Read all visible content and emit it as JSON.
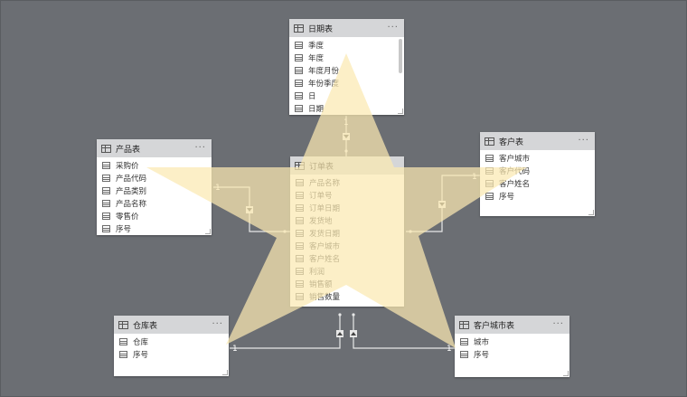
{
  "tables": {
    "date": {
      "title": "日期表",
      "fields": [
        "季度",
        "年度",
        "年度月份",
        "年份季度",
        "日",
        "日期"
      ]
    },
    "product": {
      "title": "产品表",
      "fields": [
        "采购价",
        "产品代码",
        "产品类别",
        "产品名称",
        "零售价",
        "序号"
      ]
    },
    "customer": {
      "title": "客户表",
      "fields": [
        "客户城市",
        "客户代码",
        "客户姓名",
        "序号"
      ]
    },
    "order": {
      "title": "订单表",
      "fields": [
        "产品名称",
        "订单号",
        "订单日期",
        "发货地",
        "发货日期",
        "客户城市",
        "客户姓名",
        "利润",
        "销售额",
        "销售数量"
      ]
    },
    "warehouse": {
      "title": "仓库表",
      "fields": [
        "仓库",
        "序号"
      ]
    },
    "customer_city": {
      "title": "客户城市表",
      "fields": [
        "城市",
        "序号"
      ]
    }
  },
  "relationships": {
    "one_label": "1",
    "many_label": "*",
    "date_one": "1",
    "product_one": "1",
    "customer_one": "1",
    "warehouse_one": "1",
    "city_one": "1"
  },
  "more_icon_glyph": "···",
  "colors": {
    "canvas": "#6b6e73",
    "card_header": "#d5d6d8",
    "line": "#e8e8e8",
    "star_fill": "#fbe9b2",
    "star_opacity": "0.75"
  }
}
